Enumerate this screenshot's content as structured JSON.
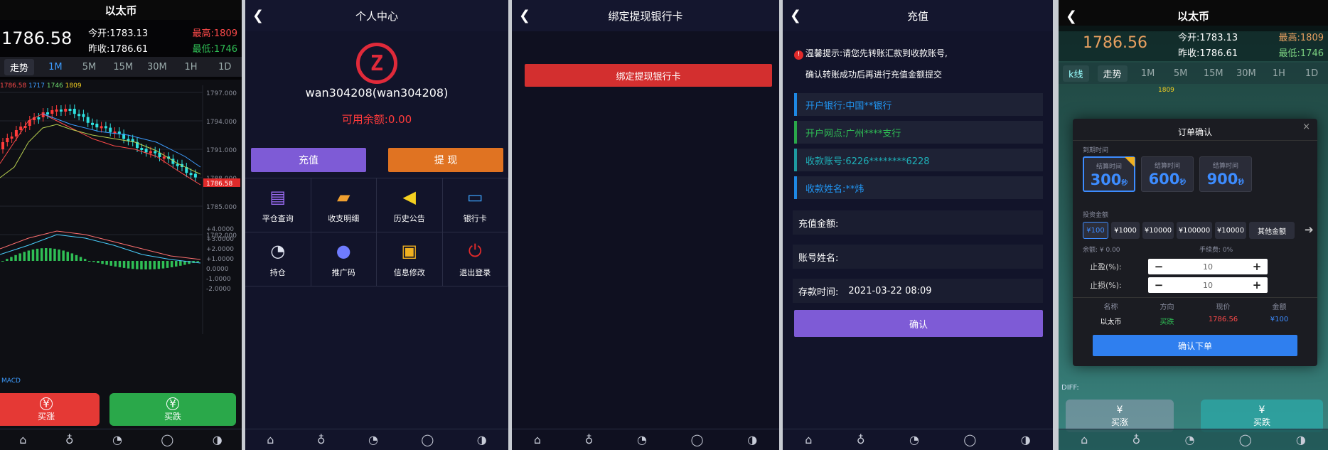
{
  "s1": {
    "title": "以太币",
    "price": "1786.58",
    "open_label": "今开:",
    "open_val": "1783.13",
    "high_label": "最高:",
    "high_val": "1809",
    "prev_label": "昨收:",
    "prev_val": "1786.61",
    "low_label": "最低:",
    "low_val": "1746",
    "tabs": [
      "走势",
      "1M",
      "5M",
      "15M",
      "30M",
      "1H",
      "1D"
    ],
    "legend": [
      "1786.58",
      "1717",
      "1746",
      "1809"
    ],
    "price_ticks": [
      "1797.000",
      "1794.000",
      "1791.000",
      "1788.000",
      "1785.000",
      "1782.000"
    ],
    "current_tag": "1786.58",
    "macd_ticks": [
      "+4.0000",
      "+3.0000",
      "+2.0000",
      "+1.0000",
      "0.0000",
      "-1.0000",
      "-2.0000"
    ],
    "macd_label": "MACD",
    "buy_up": "买涨",
    "buy_down": "买跌",
    "colors": {
      "up": "#ff3b3b",
      "down": "#2aa84a",
      "accent": "#3d9cff"
    }
  },
  "s2": {
    "title": "个人中心",
    "username": "wan304208(wan304208)",
    "balance_label": "可用余额:",
    "balance": "0.00",
    "recharge": "充值",
    "withdraw": "提 现",
    "menu": [
      {
        "label": "平仓查询",
        "icon": "search-icon",
        "glyph": "▤",
        "color": "#9c6cf5"
      },
      {
        "label": "收支明细",
        "icon": "wallet-icon",
        "glyph": "▰",
        "color": "#f0a030"
      },
      {
        "label": "历史公告",
        "icon": "megaphone-icon",
        "glyph": "◀",
        "color": "#f5d020"
      },
      {
        "label": "银行卡",
        "icon": "card-icon",
        "glyph": "▭",
        "color": "#3b9ef5"
      },
      {
        "label": "持仓",
        "icon": "chart-icon",
        "glyph": "◔",
        "color": "#e0e4f0"
      },
      {
        "label": "推广码",
        "icon": "user-icon",
        "glyph": "●",
        "color": "#6f7cff"
      },
      {
        "label": "信息修改",
        "icon": "lock-icon",
        "glyph": "▣",
        "color": "#f0b020"
      },
      {
        "label": "退出登录",
        "icon": "power-icon",
        "glyph": "⏻",
        "color": "#e02a2a"
      }
    ]
  },
  "s3": {
    "title": "绑定提现银行卡",
    "bind_button": "绑定提现银行卡"
  },
  "s4": {
    "title": "充值",
    "notice_line1": "温馨提示:请您先转账汇款到收款账号,",
    "notice_line2": "确认转账成功后再进行充值金额提交",
    "bank": "开户银行:中国**银行",
    "branch": "开户网点:广州****支行",
    "account": "收款账号:6226********6228",
    "name": "收款姓名:**炜",
    "amount_label": "充值金额:",
    "account_name_label": "账号姓名:",
    "time_label": "存款时间:",
    "time_value": "2021-03-22 08:09",
    "confirm": "确认"
  },
  "s5": {
    "title": "以太币",
    "price": "1786.56",
    "open_label": "今开:",
    "open_val": "1783.13",
    "high_label": "最高:",
    "high_val": "1809",
    "prev_label": "昨收:",
    "prev_val": "1786.61",
    "low_label": "最低:",
    "low_val": "1746",
    "tabs": [
      "k线",
      "走势",
      "1M",
      "5M",
      "15M",
      "30M",
      "1H",
      "1D"
    ],
    "legend_val": "1809",
    "diff_label": "DIFF:",
    "buy_up": "买涨",
    "buy_down": "买跌",
    "modal": {
      "title": "订单确认",
      "expiry_label": "到期时间",
      "durations": [
        {
          "label": "结算时间",
          "value": "300",
          "unit": "秒"
        },
        {
          "label": "结算时间",
          "value": "600",
          "unit": "秒"
        },
        {
          "label": "结算时间",
          "value": "900",
          "unit": "秒"
        }
      ],
      "invest_label": "投资金额",
      "amounts": [
        "¥100",
        "¥1000",
        "¥10000",
        "¥100000",
        "¥10000",
        "其他金额"
      ],
      "balance_text": "余额: ¥ 0.00",
      "fee_text": "手续费: 0%",
      "take_profit_label": "止盈(%):",
      "take_profit_val": "10",
      "stop_loss_label": "止损(%):",
      "stop_loss_val": "10",
      "table_headers": [
        "名称",
        "方向",
        "现价",
        "金额"
      ],
      "row": [
        "以太币",
        "买跌",
        "1786.56",
        "¥100"
      ],
      "submit": "确认下单"
    }
  }
}
